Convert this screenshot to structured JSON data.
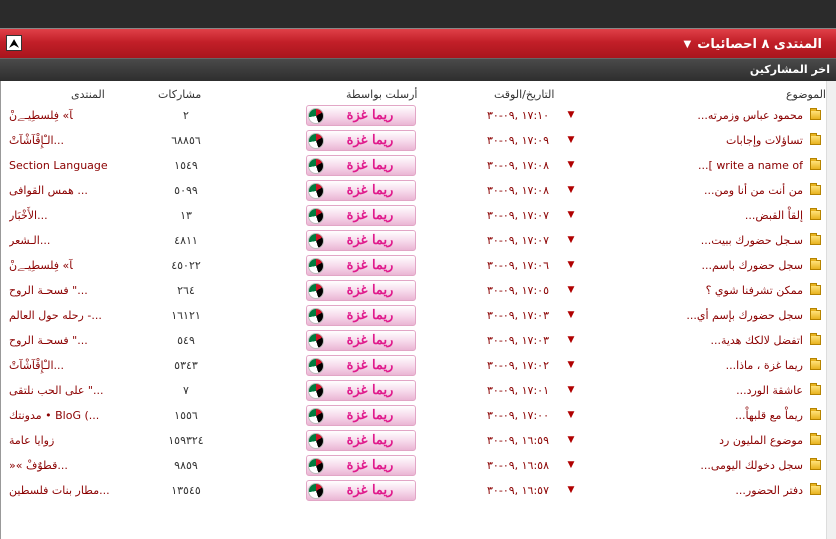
{
  "header": {
    "title": "المنتدى ٨ احصائيات",
    "subtitle": "اخر المشاركين",
    "collapse_symbol": "⮝",
    "accent_color": "#c21f28"
  },
  "columns": {
    "topic": "الموضوع",
    "datetime": "التاريخ/الوقت",
    "sent_by": "أرسلت بواسطة",
    "posts": "مشاركات",
    "forum": "المنتدى"
  },
  "rows": [
    {
      "topic": "محمود عباس وزمرته...",
      "date": "١٧:١٠ ,٠٩-٣٠",
      "user": "ريما غزة",
      "posts": "٢",
      "forum": "ﺂ» فِلسطِيـﮯنْ"
    },
    {
      "topic": "تساؤلات وإجابات",
      "date": "١٧:٠٩ ,٠٩-٣٠",
      "user": "ريما غزة",
      "posts": "٦٨٨٥٦",
      "forum": "الـْإِقْآشْآتْ..."
    },
    {
      "topic": "write a name of ]...",
      "date": "١٧:٠٨ ,٠٩-٣٠",
      "user": "ريما غزة",
      "posts": "١٥٤٩",
      "forum": "Section Language"
    },
    {
      "topic": "من أنت من أنا ومن...",
      "date": "١٧:٠٨ ,٠٩-٣٠",
      "user": "ريما غزة",
      "posts": "٥٠٩٩",
      "forum": "همس القوافى ..."
    },
    {
      "topic": "إلقاْ القبض...",
      "date": "١٧:٠٧ ,٠٩-٣٠",
      "user": "ريما غزة",
      "posts": "١٣",
      "forum": "الأَخْبَار..."
    },
    {
      "topic": "سـجل حضورك ببيت...",
      "date": "١٧:٠٧ ,٠٩-٣٠",
      "user": "ريما غزة",
      "posts": "٤٨١١",
      "forum": "الـشعر..."
    },
    {
      "topic": "سجل حضورك باسم...",
      "date": "١٧:٠٦ ,٠٩-٣٠",
      "user": "ريما غزة",
      "posts": "٤٥٠٢٢",
      "forum": "ﺂ» فِلسطِيـﮯنْ"
    },
    {
      "topic": "ممكن تشرفنا شوي ؟",
      "date": "١٧:٠٥ ,٠٩-٣٠",
      "user": "ريما غزة",
      "posts": "٢٦٤",
      "forum": "فسحـة الروح \"..."
    },
    {
      "topic": "سجل حضورك بإسم أي...",
      "date": "١٧:٠٣ ,٠٩-٣٠",
      "user": "ريما غزة",
      "posts": "١٦١٢١",
      "forum": "رحله حول العالم -..."
    },
    {
      "topic": "اتفضل لالكك هدية...",
      "date": "١٧:٠٣ ,٠٩-٣٠",
      "user": "ريما غزة",
      "posts": "٥٤٩",
      "forum": "فسحـة الروح \"..."
    },
    {
      "topic": "ريما غزة ، ماذا...",
      "date": "١٧:٠٢ ,٠٩-٣٠",
      "user": "ريما غزة",
      "posts": "٥٣٤٣",
      "forum": "الـْإِقْآشْآتْ..."
    },
    {
      "topic": "عاشقة الورد...",
      "date": "١٧:٠١ ,٠٩-٣٠",
      "user": "ريما غزة",
      "posts": "٧",
      "forum": "على الحب نلتقى \"..."
    },
    {
      "topic": "ريماْ مع قلبهاْ...",
      "date": "١٧:٠٠ ,٠٩-٣٠",
      "user": "ريما غزة",
      "posts": "١٥٥٦",
      "forum": "مدونتك • BloG (..."
    },
    {
      "topic": "موضوع المليون رد",
      "date": "١٦:٥٩ ,٠٩-٣٠",
      "user": "ريما غزة",
      "posts": "١٥٩٣٢٤",
      "forum": "زوايا عامة"
    },
    {
      "topic": "سجل دخولك اليومى...",
      "date": "١٦:٥٨ ,٠٩-٣٠",
      "user": "ريما غزة",
      "posts": "٩٨٥٩",
      "forum": "»« قطوٌفْ..."
    },
    {
      "topic": "دفتر الحضور...",
      "date": "١٦:٥٧ ,٠٩-٣٠",
      "user": "ريما غزة",
      "posts": "١٣٥٤٥",
      "forum": "مطار بنات فلسطين..."
    }
  ]
}
